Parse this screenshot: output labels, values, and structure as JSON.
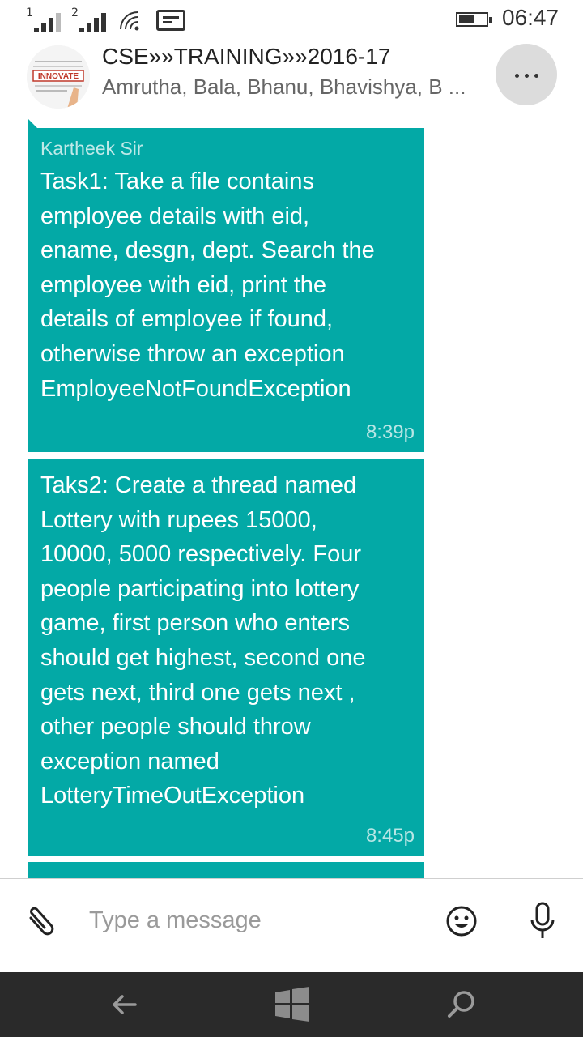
{
  "status_bar": {
    "sim1_label": "1",
    "sim2_label": "2",
    "time": "06:47",
    "battery_level": 0.55
  },
  "chat": {
    "title": "CSE»»TRAINING»»2016-17",
    "members": "Amrutha, Bala, Bhanu, Bhavishya, B ...",
    "avatar_text": "INNOVATE"
  },
  "messages": [
    {
      "sender": "Kartheek Sir",
      "lines": [
        "Task1: Take a file contains",
        "employee details with eid,",
        "ename, desgn, dept. Search the",
        "employee with eid, print the",
        "details of employee if found,",
        "otherwise throw an exception",
        "EmployeeNotFoundException"
      ],
      "time": "8:39p"
    },
    {
      "sender": "",
      "lines": [
        "Taks2: Create a thread named",
        "Lottery with rupees 15000,",
        "10000, 5000 respectively. Four",
        "people participating into lottery",
        "game, first person who enters",
        "should get highest, second one",
        "gets next, third one gets next ,",
        "other people should throw",
        "exception named",
        "LotteryTimeOutException"
      ],
      "time": "8:45p"
    }
  ],
  "compose": {
    "placeholder": "Type a message"
  },
  "icons": {
    "attach": "paperclip-icon",
    "emoji": "smiley-icon",
    "mic": "microphone-icon",
    "more": "ellipsis-icon",
    "back": "back-arrow-icon",
    "start": "windows-logo-icon",
    "search": "search-icon"
  },
  "colors": {
    "bubble": "#03a9a6",
    "navbar": "#2a2a2a"
  }
}
